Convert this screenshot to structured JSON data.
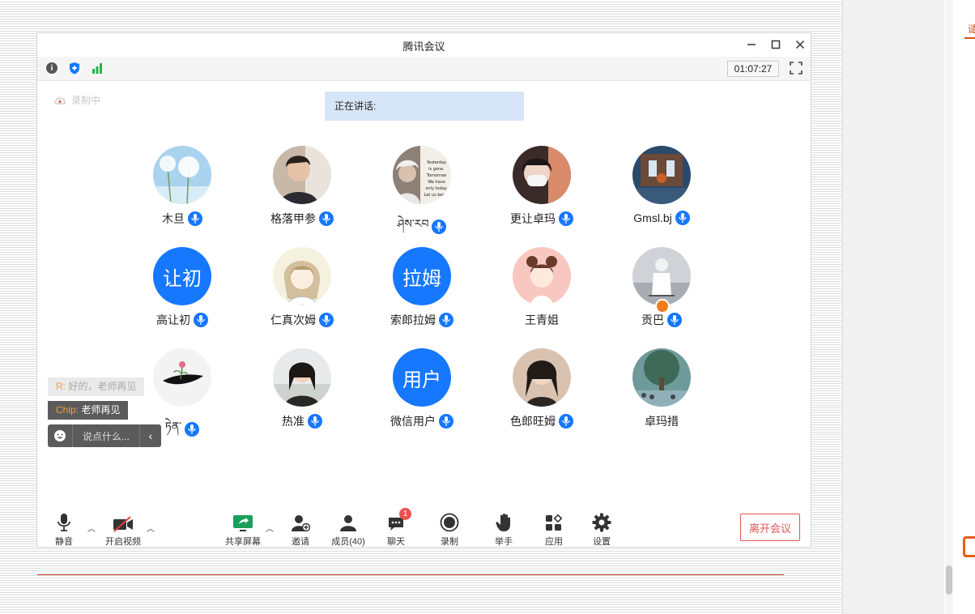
{
  "window": {
    "title": "腾讯会议",
    "timer": "01:07:27"
  },
  "recording_label": "录制中",
  "speaking_label": "正在讲话:",
  "participants": [
    {
      "name": "木旦",
      "mic": true,
      "avatar_text": ""
    },
    {
      "name": "格落甲参",
      "mic": true,
      "avatar_text": ""
    },
    {
      "name": "ཤེས་རབ",
      "mic": true,
      "avatar_text": "",
      "avatar_caption": "Yesterday is gone. Tomorrow has not yet come. We have only today. Let us begin"
    },
    {
      "name": "更让卓玛",
      "mic": true,
      "avatar_text": ""
    },
    {
      "name": "Gmsl.bj",
      "mic": true,
      "avatar_text": ""
    },
    {
      "name": "高让初",
      "mic": true,
      "avatar_text": "让初"
    },
    {
      "name": "仁真次姆",
      "mic": true,
      "avatar_text": ""
    },
    {
      "name": "索郎拉姆",
      "mic": true,
      "avatar_text": "拉姆"
    },
    {
      "name": "王青姐",
      "mic": false,
      "avatar_text": ""
    },
    {
      "name": "贡巴",
      "mic": true,
      "avatar_text": "",
      "host": true
    },
    {
      "name": "ཏེན་",
      "mic": true,
      "avatar_text": ""
    },
    {
      "name": "热准",
      "mic": true,
      "avatar_text": ""
    },
    {
      "name": "微信用户",
      "mic": true,
      "avatar_text": "用户"
    },
    {
      "name": "色郎旺姆",
      "mic": true,
      "avatar_text": ""
    },
    {
      "name": "卓玛措",
      "mic": false,
      "avatar_text": ""
    }
  ],
  "chat": {
    "msg1_from": "R:",
    "msg1_text": " 好的，老师再见",
    "msg2_from": "Chip:",
    "msg2_text": " 老师再见",
    "placeholder": "说点什么..."
  },
  "controls": {
    "mute": "静音",
    "video": "开启视频",
    "share": "共享屏幕",
    "invite": "邀请",
    "members": "成员(40)",
    "chat": "聊天",
    "chat_badge": "1",
    "record": "录制",
    "raise_hand": "举手",
    "apps": "应用",
    "settings": "设置",
    "leave": "离开会议"
  },
  "right_panel": {
    "tab_char": "谴"
  },
  "colors": {
    "accent": "#1677ff",
    "leave": "#e05555",
    "speaking_bg": "#d7e5f8"
  }
}
